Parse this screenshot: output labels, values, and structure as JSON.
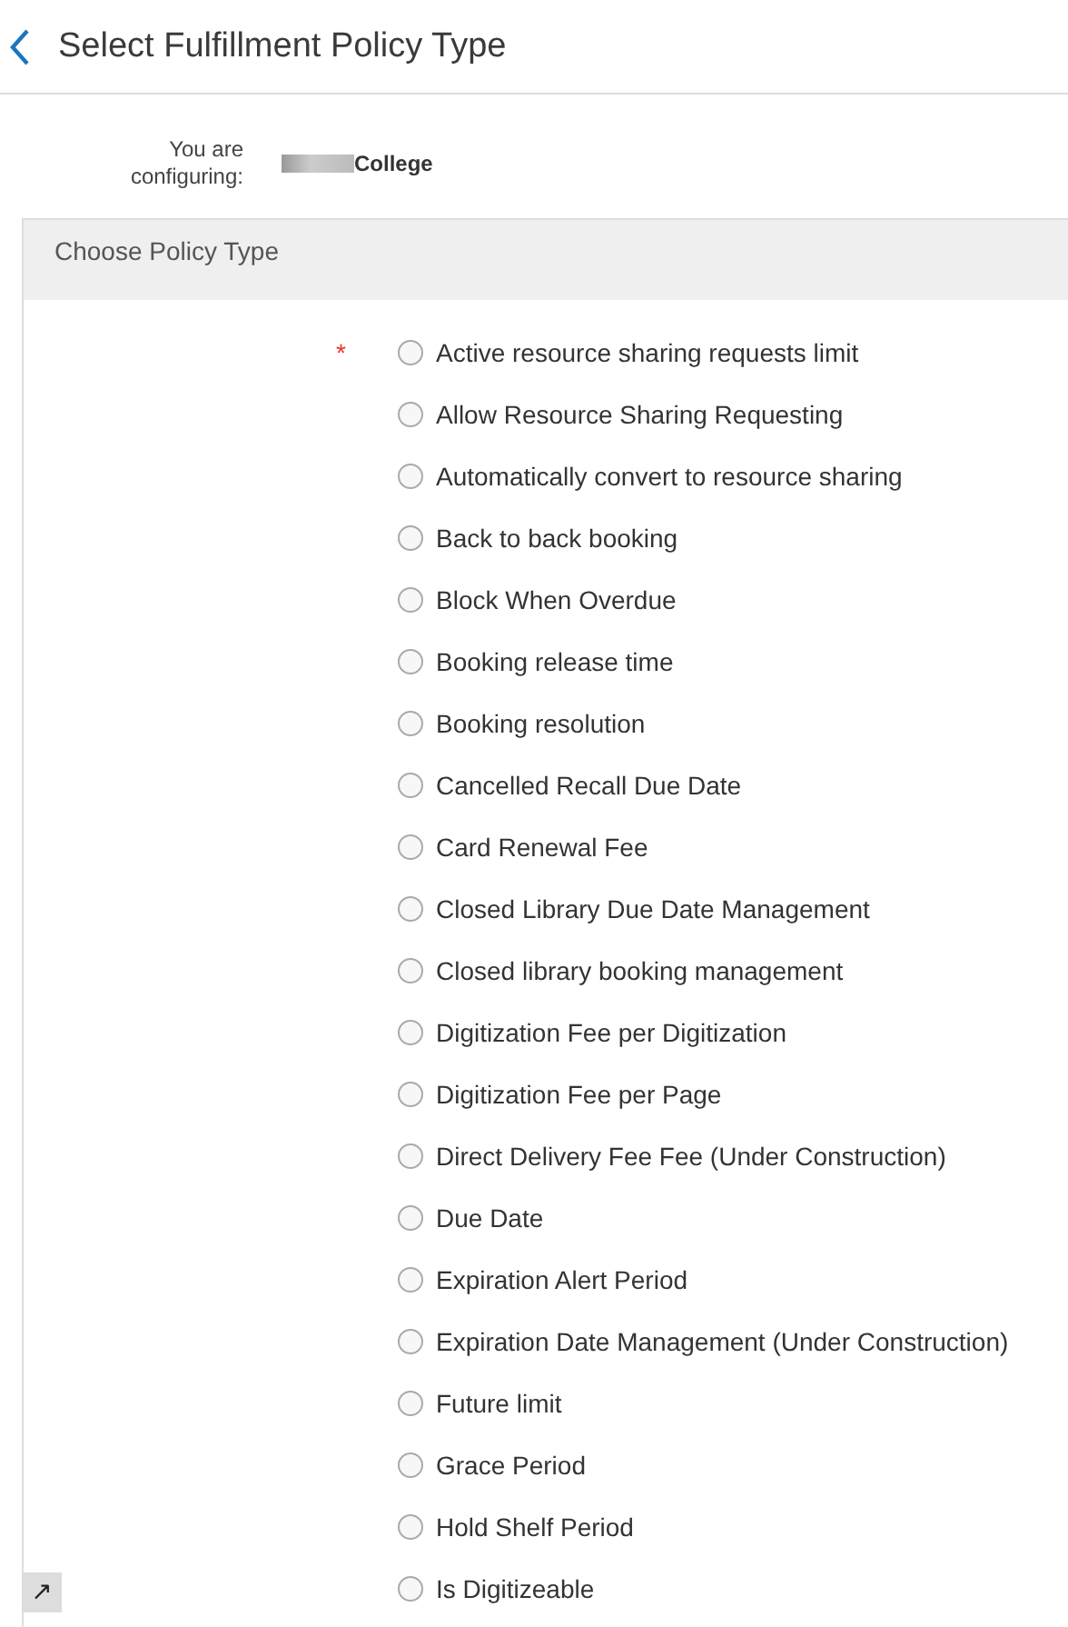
{
  "header": {
    "title": "Select Fulfillment Policy Type"
  },
  "configuring": {
    "label": "You are configuring:",
    "value": "College"
  },
  "policy_panel": {
    "title": "Choose Policy Type",
    "required_mark": "*",
    "options": [
      {
        "label": "Active resource sharing requests limit",
        "selected": false
      },
      {
        "label": "Allow Resource Sharing Requesting",
        "selected": false
      },
      {
        "label": "Automatically convert to resource sharing",
        "selected": false
      },
      {
        "label": "Back to back booking",
        "selected": false
      },
      {
        "label": "Block When Overdue",
        "selected": false
      },
      {
        "label": "Booking release time",
        "selected": false
      },
      {
        "label": "Booking resolution",
        "selected": false
      },
      {
        "label": "Cancelled Recall Due Date",
        "selected": false
      },
      {
        "label": "Card Renewal Fee",
        "selected": false
      },
      {
        "label": "Closed Library Due Date Management",
        "selected": false
      },
      {
        "label": "Closed library booking management",
        "selected": false
      },
      {
        "label": "Digitization Fee per Digitization",
        "selected": false
      },
      {
        "label": "Digitization Fee per Page",
        "selected": false
      },
      {
        "label": "Direct Delivery Fee Fee (Under Construction)",
        "selected": false
      },
      {
        "label": "Due Date",
        "selected": false
      },
      {
        "label": "Expiration Alert Period",
        "selected": false
      },
      {
        "label": "Expiration Date Management (Under Construction)",
        "selected": false
      },
      {
        "label": "Future limit",
        "selected": false
      },
      {
        "label": "Grace Period",
        "selected": false
      },
      {
        "label": "Hold Shelf Period",
        "selected": false
      },
      {
        "label": "Is Digitizeable",
        "selected": false
      }
    ]
  },
  "expand_button": {
    "label": "↗"
  }
}
